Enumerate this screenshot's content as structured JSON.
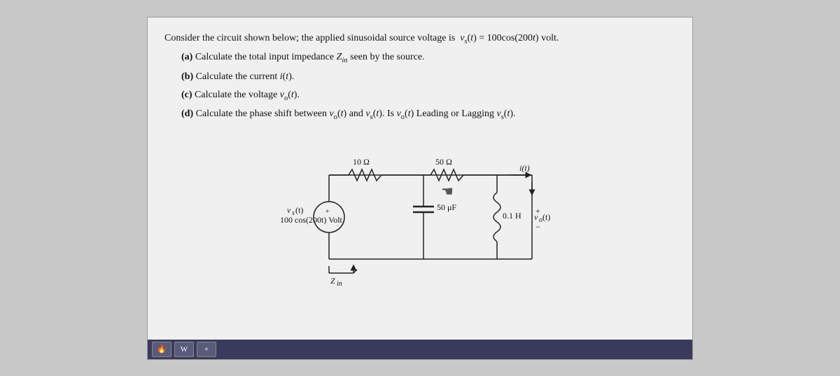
{
  "document": {
    "intro": "Consider the circuit shown below; the applied sinusoidal source voltage is",
    "vs_expr": "v_s(t) = 100cos(200t) volt.",
    "parts": [
      {
        "label": "(a)",
        "text": "Calculate the total input impedance Z",
        "sub": "in",
        "suffix": " seen by the source."
      },
      {
        "label": "(b)",
        "text": "Calculate the current i(t)."
      },
      {
        "label": "(c)",
        "text": "Calculate the voltage v",
        "sub": "o",
        "suffix": "(t)."
      },
      {
        "label": "(d)",
        "text": "Calculate the phase shift between v",
        "sub1": "o",
        "mid": "(t) and v",
        "sub2": "s",
        "suffix": "(t). Is v",
        "sub3": "o",
        "end": "(t) Leading or Lagging v",
        "sub4": "s",
        "last": "(t)."
      }
    ],
    "circuit": {
      "resistor1_label": "10 Ω",
      "resistor2_label": "50 Ω",
      "capacitor_label": "50 μF",
      "inductor_label": "0.1 H",
      "source_label": "v_s(t)",
      "source_value": "100 cos(200t) Volt",
      "current_label": "i(t)",
      "output_label": "v_o(t)",
      "zin_label": "Z_in"
    }
  },
  "taskbar": {
    "btn1": "🔥",
    "btn2": "W",
    "btn3": "+"
  }
}
